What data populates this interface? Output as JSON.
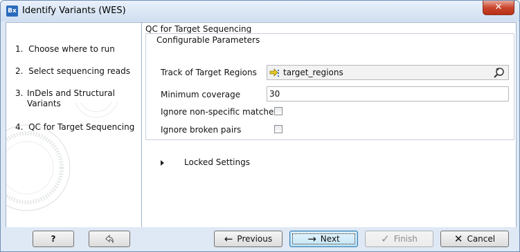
{
  "window": {
    "app_icon": "Bx",
    "title": "Identify Variants (WES)",
    "close_icon": "x-icon"
  },
  "steps": [
    {
      "number": "1.",
      "label": "Choose where to run"
    },
    {
      "number": "2.",
      "label": "Select sequencing reads"
    },
    {
      "number": "3.",
      "label": "InDels and Structural Variants"
    },
    {
      "number": "4.",
      "label": "QC for Target Sequencing"
    }
  ],
  "panel": {
    "title": "QC for Target Sequencing",
    "group_title": "Configurable Parameters",
    "track_label": "Track of Target Regions",
    "track_value": "target_regions",
    "coverage_label": "Minimum coverage",
    "coverage_value": "30",
    "nonspecific_label": "Ignore non-specific matches",
    "nonspecific_checked": false,
    "broken_label": "Ignore broken pairs",
    "broken_checked": false,
    "locked_label": "Locked Settings"
  },
  "footer": {
    "help_label": "?",
    "reset_icon": "reset-arrow-icon",
    "previous_label": "Previous",
    "next_label": "Next",
    "finish_label": "Finish",
    "cancel_label": "Cancel"
  }
}
